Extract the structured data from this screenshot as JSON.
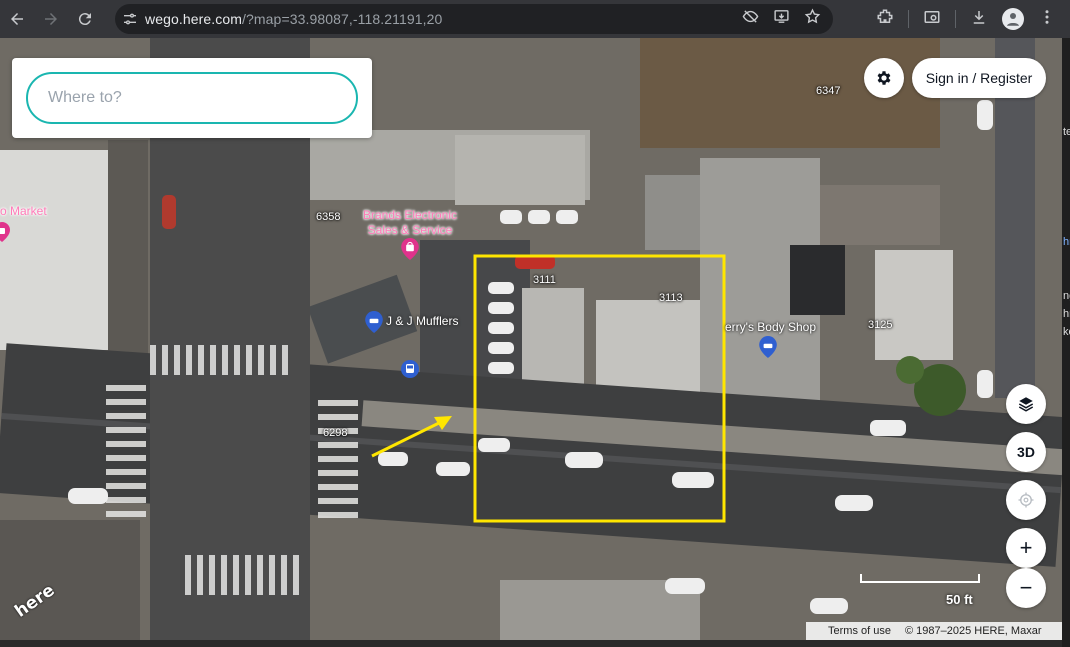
{
  "browser": {
    "url_host": "wego.here.com",
    "url_path": "/?map=33.98087,-118.21191,20"
  },
  "search": {
    "placeholder": "Where to?"
  },
  "header": {
    "signin_label": "Sign in / Register"
  },
  "map_controls": {
    "three_d_label": "3D",
    "zoom_in_label": "+",
    "zoom_out_label": "−"
  },
  "scale": {
    "label": "50 ft"
  },
  "attribution": {
    "terms_label": "Terms of use",
    "copyright": "© 1987–2025 HERE, Maxar"
  },
  "logo": {
    "text": "here"
  },
  "pois": {
    "market": "o Market",
    "brands_line1": "Brands Electronic",
    "brands_line2": "Sales & Service",
    "mufflers": "J & J Mufflers",
    "body_shop": "erry's Body Shop"
  },
  "addresses": {
    "a6347": "6347",
    "a6358": "6358",
    "a3111": "3111",
    "a3113": "3113",
    "a3125": "3125",
    "a6298": "6298"
  },
  "edge_fragments": [
    "te",
    "hn",
    "ng",
    "hn",
    "ke"
  ],
  "colors": {
    "accent": "#1ab6b0",
    "highlight": "#ffe600",
    "poi_pink": "#e0338c",
    "poi_blue": "#2f5fd0"
  }
}
